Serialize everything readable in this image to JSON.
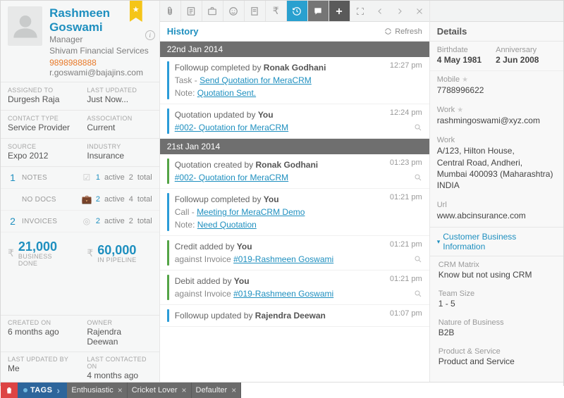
{
  "profile": {
    "name": "Rashmeen Goswami",
    "role": "Manager",
    "company": "Shivam Financial Services",
    "phone": "9898988888",
    "email": "r.goswami@bajajins.com"
  },
  "meta": {
    "assigned_to_label": "ASSIGNED TO",
    "assigned_to": "Durgesh Raja",
    "last_updated_label": "LAST UPDATED",
    "last_updated": "Just Now...",
    "contact_type_label": "CONTACT TYPE",
    "contact_type": "Service Provider",
    "association_label": "ASSOCIATION",
    "association": "Current",
    "source_label": "SOURCE",
    "source": "Expo 2012",
    "industry_label": "INDUSTRY",
    "industry": "Insurance"
  },
  "stats": {
    "notes_count": "1",
    "notes_label": "NOTES",
    "check_count": "1",
    "check_active": "active",
    "check_total": "2",
    "check_total_lab": "total",
    "nodocs_label": "NO DOCS",
    "bag_count": "2",
    "bag_active": "active",
    "bag_total": "4",
    "bag_total_lab": "total",
    "invoices_count": "2",
    "invoices_label": "INVOICES",
    "coin_count": "2",
    "coin_active": "active",
    "coin_total": "2",
    "coin_total_lab": "total"
  },
  "money": {
    "done_val": "21,000",
    "done_lab": "BUSINESS DONE",
    "pipe_val": "60,000",
    "pipe_lab": "IN PIPELINE"
  },
  "footer": {
    "created_on_label": "CREATED ON",
    "created_on": "6 months ago",
    "owner_label": "OWNER",
    "owner": "Rajendra Deewan",
    "last_updated_by_label": "LAST UPDATED BY",
    "last_updated_by": "Me",
    "last_contacted_label": "LAST CONTACTED ON",
    "last_contacted": "4 months ago"
  },
  "history": {
    "title": "History",
    "refresh": "Refresh",
    "groups": [
      {
        "date": "22nd Jan 2014",
        "items": [
          {
            "bar": "blue",
            "line": "Followup completed by",
            "who": "Ronak Godhani",
            "sub": "Task - ",
            "link": "Send Quotation for MeraCRM",
            "note_lab": "Note:",
            "note": "Quotation Sent.",
            "time": "12:27 pm"
          },
          {
            "bar": "blue",
            "line": "Quotation updated by",
            "who": "You",
            "link": "#002- Quotation for MeraCRM",
            "time": "12:24 pm",
            "mag": true
          }
        ]
      },
      {
        "date": "21st Jan 2014",
        "items": [
          {
            "bar": "green",
            "line": "Quotation created by",
            "who": "Ronak Godhani",
            "link": "#002- Quotation for MeraCRM",
            "time": "01:23 pm",
            "mag": true
          },
          {
            "bar": "blue",
            "line": "Followup completed by",
            "who": "You",
            "sub": "Call - ",
            "link": "Meeting for MeraCRM Demo",
            "note_lab": "Note:",
            "note": "Need Quotation",
            "time": "01:21 pm"
          },
          {
            "bar": "green",
            "line": "Credit added by",
            "who": "You",
            "sub": "against Invoice ",
            "link": "#019-Rashmeen Goswami",
            "time": "01:21 pm",
            "mag": true
          },
          {
            "bar": "green",
            "line": "Debit added by",
            "who": "You",
            "sub": "against Invoice ",
            "link": "#019-Rashmeen Goswami",
            "time": "01:21 pm",
            "mag": true
          },
          {
            "bar": "blue",
            "line": "Followup updated by",
            "who": "Rajendra Deewan",
            "time": "01:07 pm"
          }
        ]
      }
    ]
  },
  "details": {
    "title": "Details",
    "birthdate_lab": "Birthdate",
    "birthdate": "4 May 1981",
    "anniv_lab": "Anniversary",
    "anniv": "2 Jun 2008",
    "mobile_lab": "Mobile",
    "mobile": "7788996622",
    "work_email_lab": "Work",
    "work_email": "rashmingoswami@xyz.com",
    "work_addr_lab": "Work",
    "work_addr": "A/123, Hilton House,\nCentral Road, Andheri,\nMumbai 400093 (Maharashtra) INDIA",
    "url_lab": "Url",
    "url": "www.abcinsurance.com",
    "biz_head": "Customer Business Information",
    "biz": [
      {
        "lab": "CRM Matrix",
        "val": "Know but not using CRM"
      },
      {
        "lab": "Team Size",
        "val": "1 - 5"
      },
      {
        "lab": "Nature of Business",
        "val": "B2B"
      },
      {
        "lab": "Product & Service",
        "val": "Product and Service"
      }
    ]
  },
  "tags": {
    "label": "TAGS",
    "items": [
      "Enthusiastic",
      "Cricket Lover",
      "Defaulter"
    ]
  }
}
